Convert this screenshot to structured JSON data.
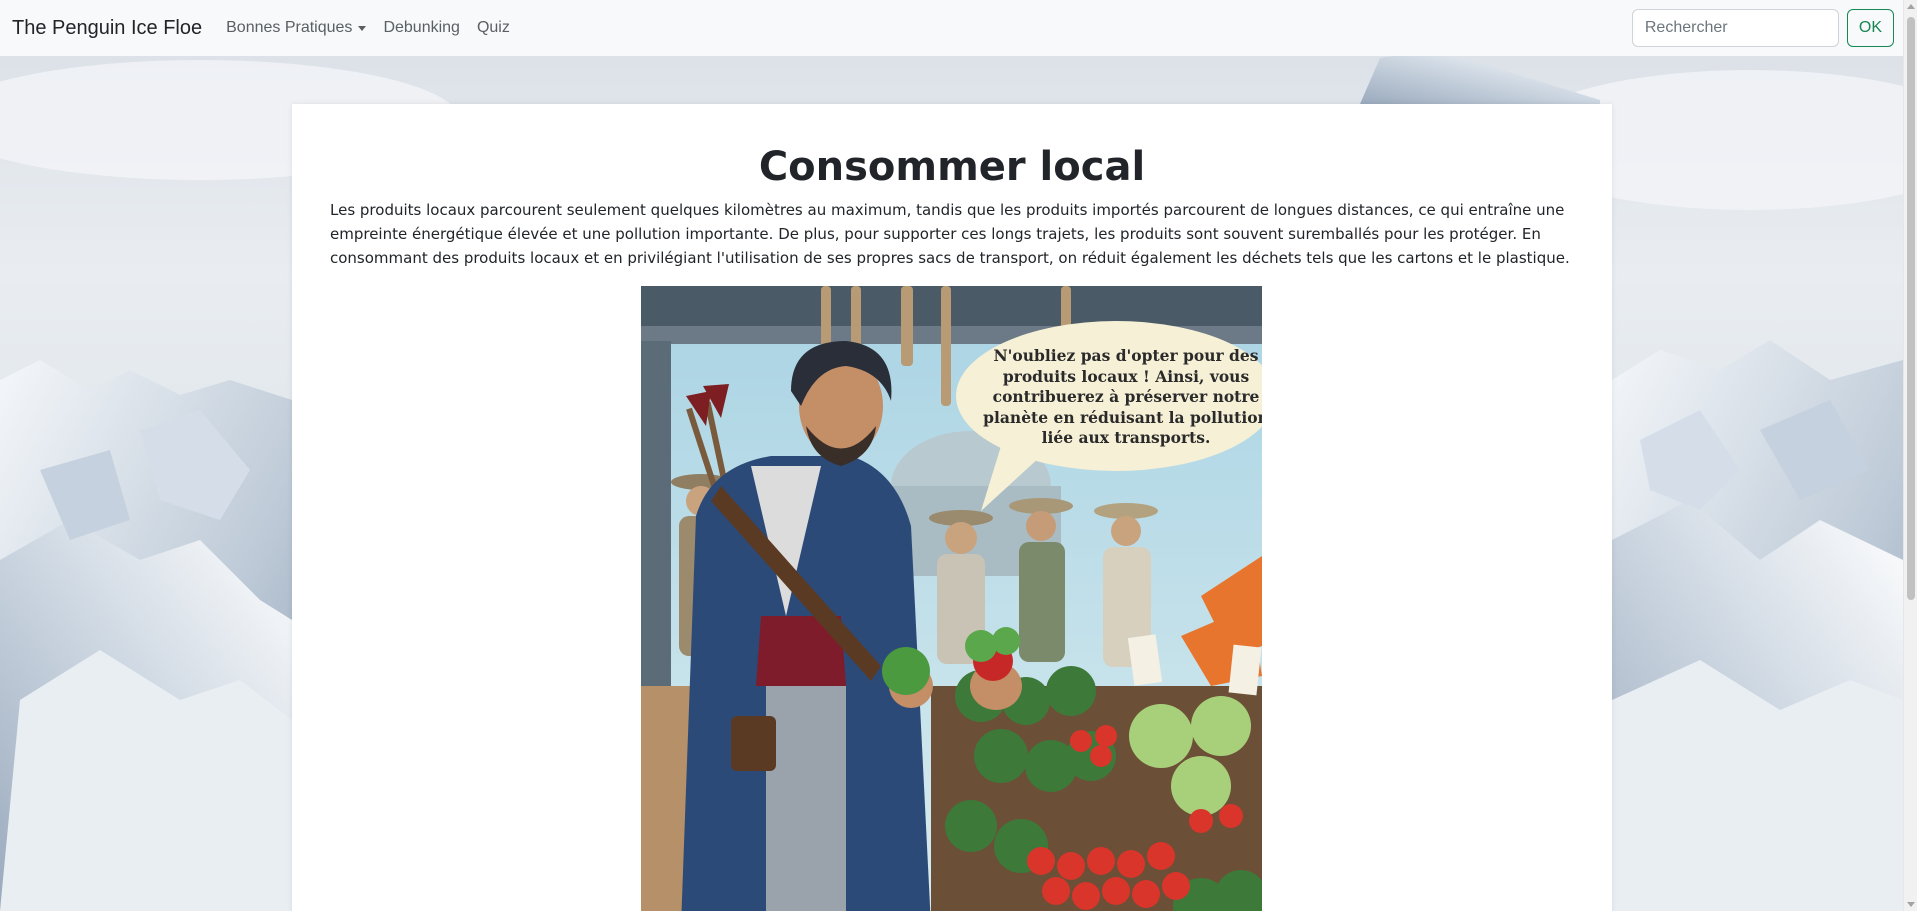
{
  "navbar": {
    "brand": "The Penguin Ice Floe",
    "links": [
      {
        "label": "Bonnes Pratiques",
        "dropdown": true
      },
      {
        "label": "Debunking",
        "dropdown": false
      },
      {
        "label": "Quiz",
        "dropdown": false
      }
    ],
    "search": {
      "placeholder": "Rechercher",
      "value": ""
    },
    "submit_label": "OK"
  },
  "main": {
    "title": "Consommer local",
    "paragraph": "Les produits locaux parcourent seulement quelques kilomètres au maximum, tandis que les produits importés parcourent de longues distances, ce qui entraîne une empreinte énergétique élevée et une pollution importante. De plus, pour supporter ces longs trajets, les produits sont souvent suremballés pour les protéger. En consommant des produits locaux et en privilégiant l'utilisation de ses propres sacs de transport, on réduit également les déchets tels que les cartons et le plastique.",
    "illustration": {
      "speech_bubble": "N'oubliez pas d'opter pour des produits locaux ! Ainsi, vous contribuerez à préserver notre planète en réduisant la pollution liée aux transports."
    }
  },
  "colors": {
    "navbar_bg": "#f8f9fa",
    "ok_button": "#198754",
    "card_bg": "#ffffff",
    "coat_blue": "#2c4a78"
  }
}
